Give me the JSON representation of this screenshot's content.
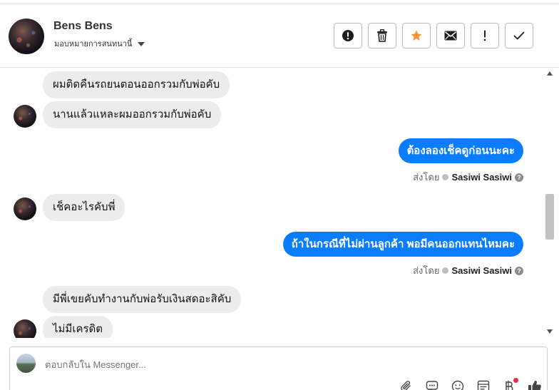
{
  "header": {
    "contact_name": "Bens Bens",
    "assign_label": "มอบหมายการสนทนานี้",
    "actions": [
      {
        "name": "alert-circle-icon",
        "label": "spam"
      },
      {
        "name": "trash-icon",
        "label": "delete"
      },
      {
        "name": "star-icon",
        "label": "star",
        "color": "#f7923b"
      },
      {
        "name": "envelope-icon",
        "label": "mark unread"
      },
      {
        "name": "exclamation-icon",
        "label": "follow up"
      },
      {
        "name": "check-icon",
        "label": "done"
      }
    ]
  },
  "messages": [
    {
      "direction": "in",
      "text": "ผมติดคืนรถยนตอนออกรวมกับพ่อคับ"
    },
    {
      "direction": "in",
      "text": "นานแล้วแหละผมออกรวมกับพ่อคับ"
    },
    {
      "direction": "out",
      "text": "ต้องลองเช็คดูก่อนนะคะ",
      "sent_by_label": "ส่งโดย",
      "sender": "Sasiwi Sasiwi"
    },
    {
      "direction": "in",
      "text": "เช็คอะไรคับพี่"
    },
    {
      "direction": "out",
      "text": "ถ้าในกรณีที่ไม่ผ่านลูกค้า พอมีคนออกแทนไหมคะ",
      "sent_by_label": "ส่งโดย",
      "sender": "Sasiwi Sasiwi"
    },
    {
      "direction": "in",
      "text": "มีพี่เขยคับทำงานกับพ่อรับเงินสดอะสิคับ"
    },
    {
      "direction": "in",
      "text": "ไม่มีเครดิต"
    }
  ],
  "composer": {
    "placeholder": "ตอบกลับใน Messenger...",
    "tools": [
      "paperclip-icon",
      "saved-reply-icon",
      "emoji-icon",
      "template-icon",
      "payment-icon",
      "thumbs-up-icon"
    ]
  },
  "colors": {
    "outgoing_bubble": "#0a7cff",
    "incoming_bubble": "#ececec",
    "star": "#f7923b",
    "notification_dot": "#f02849"
  }
}
